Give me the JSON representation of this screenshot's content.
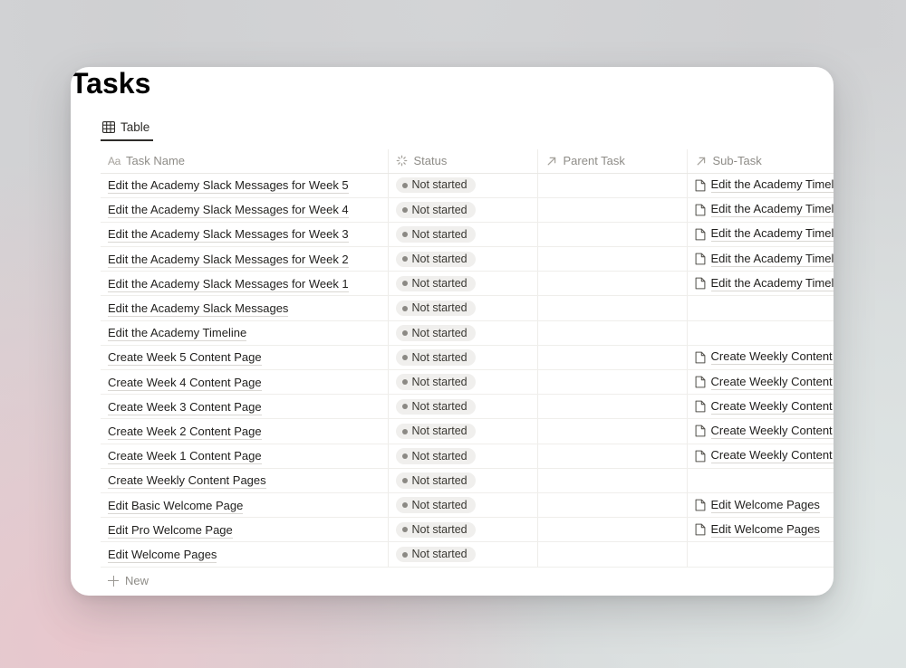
{
  "page": {
    "title": "Tasks"
  },
  "view_tabs": [
    {
      "label": "Table",
      "icon": "table-grid-icon",
      "active": true
    }
  ],
  "table": {
    "columns": [
      {
        "key": "task_name",
        "label": "Task Name",
        "icon": "text-aa-icon"
      },
      {
        "key": "status",
        "label": "Status",
        "icon": "status-spinner-icon"
      },
      {
        "key": "parent_task",
        "label": "Parent Task",
        "icon": "arrow-up-right-icon"
      },
      {
        "key": "sub_task",
        "label": "Sub-Task",
        "icon": "arrow-up-right-icon"
      }
    ],
    "rows": [
      {
        "task_name": "Edit the Academy Slack Messages for Week 5",
        "status": "Not started",
        "parent_task": "",
        "sub_task": "Edit the Academy Timeline"
      },
      {
        "task_name": "Edit the Academy Slack Messages for Week 4",
        "status": "Not started",
        "parent_task": "",
        "sub_task": "Edit the Academy Timeline"
      },
      {
        "task_name": "Edit the Academy Slack Messages for Week 3",
        "status": "Not started",
        "parent_task": "",
        "sub_task": "Edit the Academy Timeline"
      },
      {
        "task_name": "Edit the Academy Slack Messages for Week 2",
        "status": "Not started",
        "parent_task": "",
        "sub_task": "Edit the Academy Timeline"
      },
      {
        "task_name": "Edit the Academy Slack Messages for Week 1",
        "status": "Not started",
        "parent_task": "",
        "sub_task": "Edit the Academy Timeline"
      },
      {
        "task_name": "Edit the Academy Slack Messages",
        "status": "Not started",
        "parent_task": "",
        "sub_task": ""
      },
      {
        "task_name": "Edit the Academy Timeline",
        "status": "Not started",
        "parent_task": "",
        "sub_task": ""
      },
      {
        "task_name": "Create Week 5 Content Page",
        "status": "Not started",
        "parent_task": "",
        "sub_task": "Create Weekly Content Pages"
      },
      {
        "task_name": "Create Week 4 Content Page",
        "status": "Not started",
        "parent_task": "",
        "sub_task": "Create Weekly Content Pages"
      },
      {
        "task_name": "Create Week 3 Content Page",
        "status": "Not started",
        "parent_task": "",
        "sub_task": "Create Weekly Content Pages"
      },
      {
        "task_name": "Create Week 2 Content Page",
        "status": "Not started",
        "parent_task": "",
        "sub_task": "Create Weekly Content Pages"
      },
      {
        "task_name": "Create Week 1 Content Page",
        "status": "Not started",
        "parent_task": "",
        "sub_task": "Create Weekly Content Pages"
      },
      {
        "task_name": "Create Weekly Content Pages",
        "status": "Not started",
        "parent_task": "",
        "sub_task": ""
      },
      {
        "task_name": "Edit Basic Welcome Page",
        "status": "Not started",
        "parent_task": "",
        "sub_task": "Edit Welcome Pages"
      },
      {
        "task_name": "Edit Pro Welcome Page",
        "status": "Not started",
        "parent_task": "",
        "sub_task": "Edit Welcome Pages"
      },
      {
        "task_name": "Edit Welcome Pages",
        "status": "Not started",
        "parent_task": "",
        "sub_task": ""
      }
    ]
  },
  "footer": {
    "new_row_label": "New",
    "new_row_icon": "plus-icon"
  },
  "colors": {
    "card_background": "#ffffff",
    "text_primary": "#201f1d",
    "text_muted": "#8e8c87",
    "status_pill_background": "#f0efed",
    "status_dot": "#8b8984",
    "row_divider": "#efeeeb",
    "backdrop_pink": "#e8c7cd",
    "backdrop_gray": "#d3d4d6",
    "backdrop_blue_gray": "#dfe6e5"
  }
}
